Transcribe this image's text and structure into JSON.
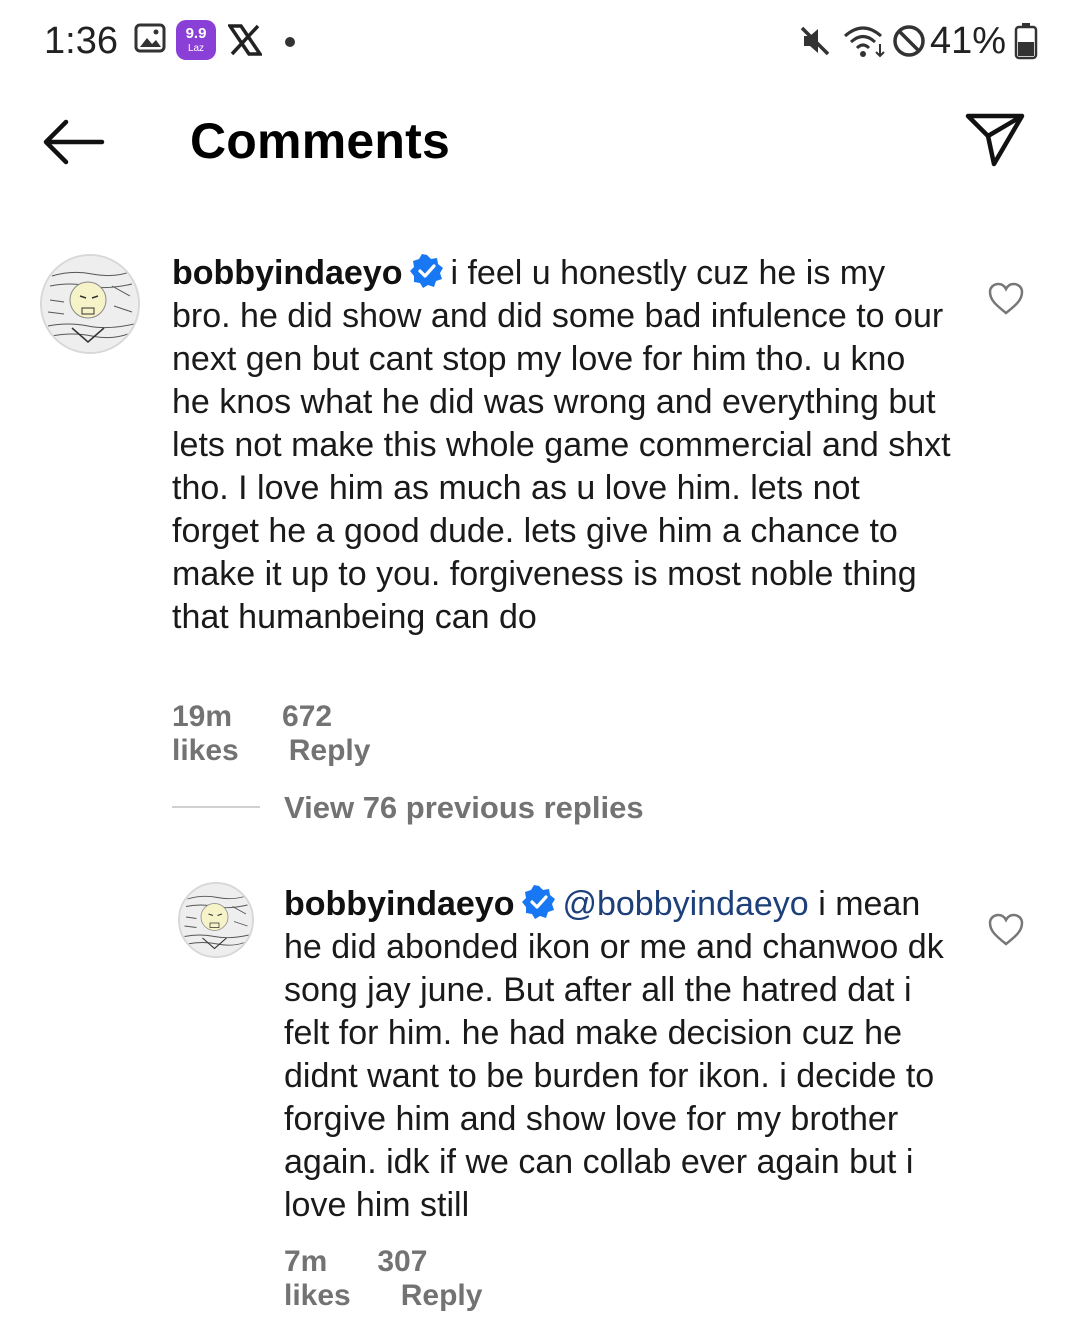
{
  "status_bar": {
    "time": "1:36",
    "notification_icons": [
      "gallery-icon",
      "lazada-icon",
      "x-icon",
      "dot-icon"
    ],
    "system_icons": [
      "mute-icon",
      "wifi-icon",
      "do-not-disturb-icon"
    ],
    "battery": "41%",
    "badge_text": "9.9",
    "badge_sub": "Laz"
  },
  "header": {
    "title": "Comments",
    "back_icon": "arrow-left-icon",
    "share_icon": "send-icon"
  },
  "comments": [
    {
      "username": "bobbyindaeyo",
      "verified": true,
      "text": "i feel u honestly cuz he is my bro. he did show and did some bad infulence to our next gen but cant stop my love for him tho. u kno he knos what he did was wrong and everything but lets not make this whole game commercial and shxt tho. I love him as much as u love him. lets not forget he a good dude. lets give him a chance to make it up to you. forgiveness is most noble thing that humanbeing can do",
      "time": "19m",
      "likes": "672 likes",
      "reply": "Reply"
    }
  ],
  "view_replies": "View 76 previous replies",
  "reply_comment": {
    "username": "bobbyindaeyo",
    "verified": true,
    "mention": "@bobbyindaeyo",
    "text": "i mean he did abonded ikon or me and chanwoo dk song jay  june. But after all the hatred dat i felt for him. he had make decision cuz he didnt want to be burden for ikon. i decide to forgive him and show love for my brother again. idk if we can collab ever again but i love him still",
    "time": "7m",
    "likes": "307 likes",
    "reply": "Reply"
  },
  "colors": {
    "verified_blue": "#1877f2",
    "meta_gray": "#737373",
    "mention": "#1d3f7a"
  }
}
